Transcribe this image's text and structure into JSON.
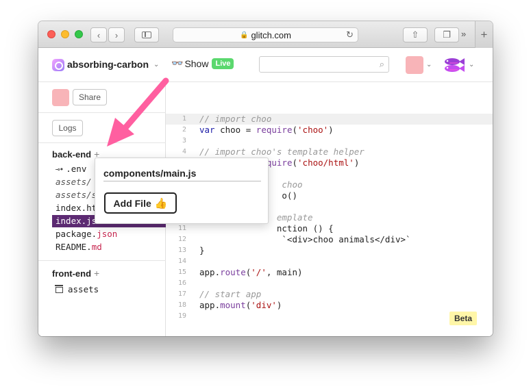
{
  "browser": {
    "url": "glitch.com",
    "tab_overflow": "»",
    "new_tab": "+"
  },
  "header": {
    "project_name": "absorbing-carbon",
    "show_label": "Show",
    "live_badge": "Live",
    "search_placeholder": ""
  },
  "sidebar": {
    "share_label": "Share",
    "logs_label": "Logs",
    "backend": {
      "title": "back-end",
      "add": "+",
      "files": [
        {
          "name": ".env",
          "ext": "",
          "italic": false
        },
        {
          "name": "assets/",
          "ext": "",
          "italic": true
        },
        {
          "name": "assets/s",
          "ext": "",
          "italic": true
        },
        {
          "name": "index.ht",
          "ext": "",
          "italic": false
        },
        {
          "name": "index.js",
          "ext": "",
          "italic": false,
          "active": true
        },
        {
          "name": "package.",
          "ext": "json",
          "italic": false
        },
        {
          "name": "README.",
          "ext": "md",
          "italic": false
        }
      ]
    },
    "frontend": {
      "title": "front-end",
      "add": "+",
      "files": [
        {
          "name": "assets"
        }
      ]
    }
  },
  "editor": {
    "lines": [
      {
        "n": "1",
        "text": "// import choo",
        "type": "comment"
      },
      {
        "n": "2",
        "text": "var choo = require('choo')",
        "type": "code"
      },
      {
        "n": "3",
        "text": "",
        "type": "code"
      },
      {
        "n": "4",
        "text": "// import choo's template helper",
        "type": "comment"
      },
      {
        "n": "5",
        "text": "var html = require('choo/html')",
        "type": "code"
      },
      {
        "n": "6",
        "text": "",
        "type": "code"
      },
      {
        "n": "7",
        "text": "                choo",
        "type": "comment"
      },
      {
        "n": "8",
        "text": "                o()",
        "type": "code"
      },
      {
        "n": "9",
        "text": "",
        "type": "code"
      },
      {
        "n": "10",
        "text": "               emplate",
        "type": "comment"
      },
      {
        "n": "11",
        "text": "               nction () {",
        "type": "code"
      },
      {
        "n": "12",
        "text": "                `<div>choo animals</div>`",
        "type": "code"
      },
      {
        "n": "13",
        "text": "}",
        "type": "code"
      },
      {
        "n": "14",
        "text": "",
        "type": "code"
      },
      {
        "n": "15",
        "text": "app.route('/', main)",
        "type": "code"
      },
      {
        "n": "16",
        "text": "",
        "type": "code"
      },
      {
        "n": "17",
        "text": "// start app",
        "type": "comment"
      },
      {
        "n": "18",
        "text": "app.mount('div')",
        "type": "code"
      },
      {
        "n": "19",
        "text": "",
        "type": "code"
      }
    ],
    "beta_badge": "Beta"
  },
  "popover": {
    "filename_value": "components/main.js",
    "add_button_label": "Add File",
    "add_button_emoji": "👍"
  },
  "colors": {
    "active_file_bg": "#5c2a72",
    "live_green": "#5bd86e",
    "arrow_pink": "#ff5fa0",
    "beta_yellow": "#fff6a8"
  }
}
